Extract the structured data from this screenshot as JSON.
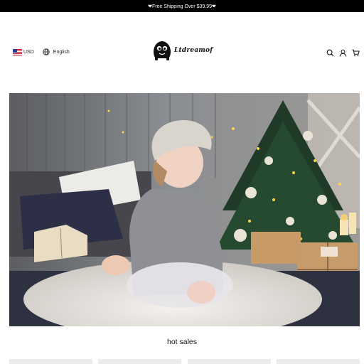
{
  "announcement": "❤Free Shipping Over $39.99❤",
  "header": {
    "currency": "USD",
    "language": "English",
    "logo_text": "Ltdreamof"
  },
  "icons": {
    "flag": "us-flag-icon",
    "language": "globe-icon",
    "search": "search-icon",
    "account": "user-icon",
    "cart": "cart-icon"
  },
  "hero": {
    "subject": "hero-image"
  },
  "section": {
    "title": "hot sales"
  },
  "product_cards": [
    {
      "name": "product-card-1"
    },
    {
      "name": "product-card-2"
    },
    {
      "name": "product-card-3"
    },
    {
      "name": "product-card-4"
    }
  ],
  "colors": {
    "announcement_bg": "#000000",
    "announcement_text": "#ffffff",
    "page_bg": "#ffffff"
  }
}
